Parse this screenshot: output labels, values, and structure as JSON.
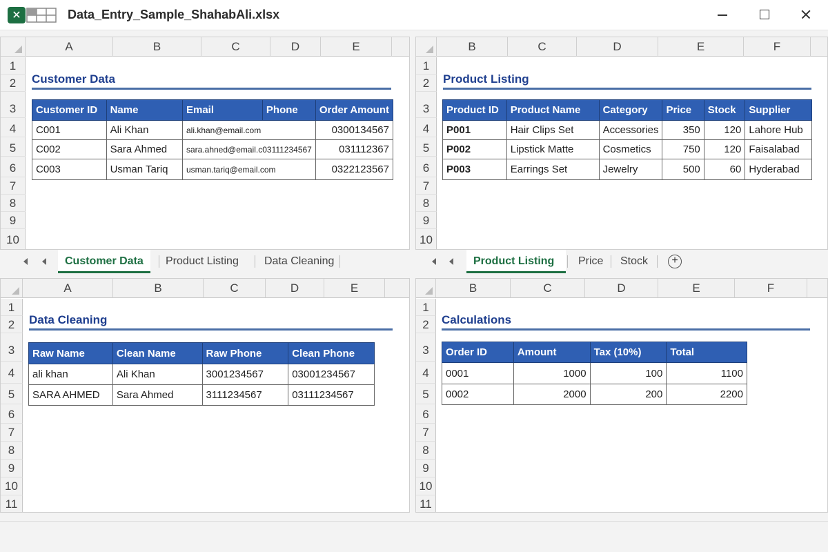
{
  "window": {
    "title": "Data_Entry_Sample_ShahabAli.xlsx",
    "app_icon": "excel-icon"
  },
  "panes": [
    {
      "id": "customer",
      "columns": [
        "A",
        "B",
        "C",
        "D",
        "E"
      ],
      "rows": [
        "1",
        "2",
        "3",
        "4",
        "5",
        "6",
        "7",
        "8",
        "9",
        "10"
      ],
      "title": "Customer Data",
      "table": {
        "headers": [
          "Customer ID",
          "Name",
          "Email",
          "Phone",
          "Order Amount"
        ],
        "rows": [
          [
            "C001",
            "Ali Khan",
            "ali.khan@email.com",
            "",
            "0300134567"
          ],
          [
            "C002",
            "Sara Ahmed",
            "sara.ahned@email.c03111234567",
            "",
            "031112367"
          ],
          [
            "C003",
            "Usman Tariq",
            "usman.tariq@email.com",
            "",
            "0322123567"
          ]
        ]
      }
    },
    {
      "id": "product",
      "columns": [
        "B",
        "C",
        "D",
        "E",
        "F"
      ],
      "rows": [
        "1",
        "2",
        "3",
        "4",
        "5",
        "6",
        "7",
        "8",
        "9",
        "10"
      ],
      "title": "Product Listing",
      "table": {
        "headers": [
          "Product ID",
          "Product Name",
          "Category",
          "Price",
          "Stock",
          "Supplier"
        ],
        "rows": [
          [
            "P001",
            "Hair Clips Set",
            "Accessories",
            "350",
            "120",
            "Lahore Hub"
          ],
          [
            "P002",
            "Lipstick Matte",
            "Cosmetics",
            "750",
            "120",
            "Faisalabad"
          ],
          [
            "P003",
            "Earrings Set",
            "Jewelry",
            "500",
            "60",
            "Hyderabad"
          ]
        ]
      }
    },
    {
      "id": "cleaning",
      "columns": [
        "A",
        "B",
        "C",
        "D",
        "E"
      ],
      "rows": [
        "1",
        "2",
        "3",
        "4",
        "5",
        "6",
        "7",
        "8",
        "9",
        "10",
        "11"
      ],
      "title": "Data Cleaning",
      "table": {
        "headers": [
          "Raw Name",
          "Clean Name",
          "Raw Phone",
          "Clean Phone"
        ],
        "rows": [
          [
            "ali khan",
            "Ali Khan",
            "3001234567",
            "03001234567"
          ],
          [
            "SARA AHMED",
            "Sara Ahmed",
            "3111234567",
            "03111234567"
          ]
        ]
      }
    },
    {
      "id": "calc",
      "columns": [
        "B",
        "C",
        "D",
        "E",
        "F"
      ],
      "rows": [
        "1",
        "2",
        "3",
        "4",
        "5",
        "6",
        "7",
        "8",
        "9",
        "10",
        "11"
      ],
      "title": "Calculations",
      "table": {
        "headers": [
          "Order ID",
          "Amount",
          "Tax (10%)",
          "Total"
        ],
        "rows": [
          [
            "0001",
            "1000",
            "100",
            "1100"
          ],
          [
            "0002",
            "2000",
            "200",
            "2200"
          ]
        ]
      }
    }
  ],
  "tabbars": {
    "left": {
      "tabs": [
        "Customer Data",
        "Product  Listing",
        "Data Cleaning"
      ],
      "active": "Customer Data"
    },
    "right": {
      "tabs": [
        "Product Listing",
        "Price",
        "Stock"
      ],
      "active": "Product Listing",
      "add": "+"
    }
  },
  "colors": {
    "excel_green": "#1d6f42",
    "header_blue": "#2f5fb3",
    "title_blue": "#1f3f8f"
  }
}
